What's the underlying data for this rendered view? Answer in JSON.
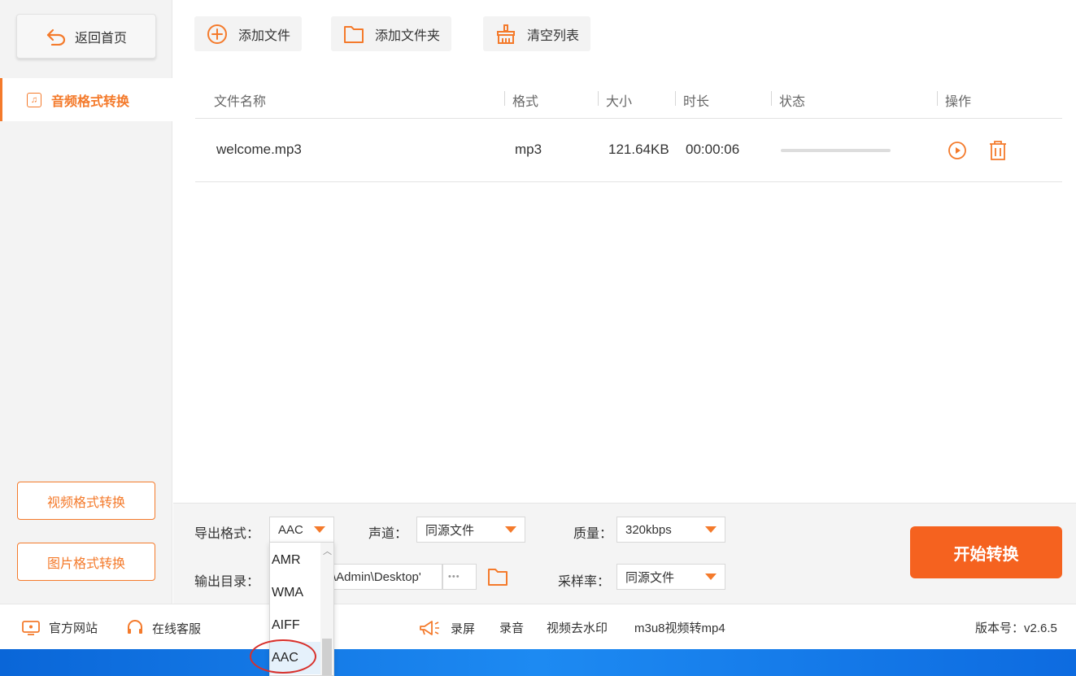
{
  "sidebar": {
    "back_label": "返回首页",
    "active_label": "音频格式转换",
    "video_label": "视频格式转换",
    "image_label": "图片格式转换"
  },
  "toolbar": {
    "add_file": "添加文件",
    "add_folder": "添加文件夹",
    "clear_list": "清空列表"
  },
  "table": {
    "columns": [
      "文件名称",
      "格式",
      "大小",
      "时长",
      "状态",
      "操作"
    ],
    "rows": [
      {
        "name": "welcome.mp3",
        "format": "mp3",
        "size": "121.64KB",
        "duration": "00:00:06",
        "progress": 0
      }
    ]
  },
  "settings": {
    "format_label": "导出格式：",
    "format_value": "AAC",
    "channel_label": "声道：",
    "channel_value": "同源文件",
    "quality_label": "质量：",
    "quality_value": "320kbps",
    "output_label": "输出目录：",
    "output_value": "\\Admin\\Desktop'",
    "output_more": "•••",
    "samplerate_label": "采样率：",
    "samplerate_value": "同源文件",
    "start_label": "开始转换"
  },
  "dropdown": {
    "options": [
      "AMR",
      "WMA",
      "AIFF",
      "AAC"
    ],
    "selected": "AAC"
  },
  "footer": {
    "website": "官方网站",
    "support": "在线客服",
    "links": [
      "录屏",
      "录音",
      "视频去水印",
      "m3u8视频转mp4"
    ],
    "version": "版本号：v2.6.5"
  },
  "colors": {
    "accent": "#f47a2b",
    "start_button": "#f5621f",
    "taskbar": "#1d8af2"
  }
}
